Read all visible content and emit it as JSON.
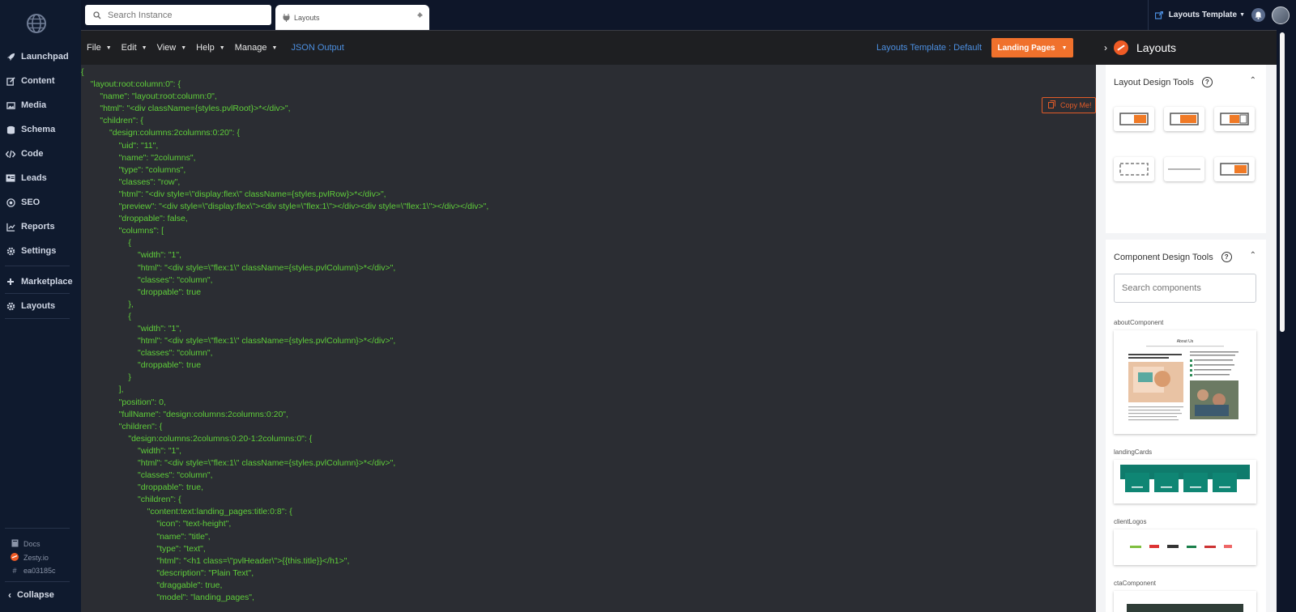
{
  "sidebar": {
    "items": [
      {
        "label": "Launchpad",
        "icon": "rocket-icon"
      },
      {
        "label": "Content",
        "icon": "edit-icon"
      },
      {
        "label": "Media",
        "icon": "image-icon"
      },
      {
        "label": "Schema",
        "icon": "database-icon"
      },
      {
        "label": "Code",
        "icon": "code-icon"
      },
      {
        "label": "Leads",
        "icon": "address-card-icon"
      },
      {
        "label": "SEO",
        "icon": "target-icon"
      },
      {
        "label": "Reports",
        "icon": "chart-icon"
      },
      {
        "label": "Settings",
        "icon": "gear-icon"
      },
      {
        "label": "Marketplace",
        "icon": "plus-icon"
      },
      {
        "label": "Layouts",
        "icon": "gear-icon"
      }
    ],
    "footer": {
      "docs": "Docs",
      "zesty": "Zesty.io",
      "hash": "ea03185c"
    },
    "collapse_label": "Collapse"
  },
  "topbar": {
    "search_placeholder": "Search Instance",
    "tab_label": "Layouts",
    "template_link": "Layouts Template"
  },
  "menubar": {
    "file": "File",
    "edit": "Edit",
    "view": "View",
    "help": "Help",
    "manage": "Manage",
    "json_output": "JSON Output",
    "template_label": "Layouts Template : Default",
    "landing_button": "Landing Pages"
  },
  "code": {
    "copy_label": "Copy Me!",
    "lines": [
      "{",
      "    \"layout:root:column:0\": {",
      "        \"name\": \"layout:root:column:0\",",
      "        \"html\": \"<div className={styles.pvlRoot}>*</div>\",",
      "        \"children\": {",
      "            \"design:columns:2columns:0:20\": {",
      "                \"uid\": \"11\",",
      "                \"name\": \"2columns\",",
      "                \"type\": \"columns\",",
      "                \"classes\": \"row\",",
      "                \"html\": \"<div style=\\\"display:flex\\\" className={styles.pvlRow}>*</div>\",",
      "                \"preview\": \"<div style=\\\"display:flex\\\"><div style=\\\"flex:1\\\"></div><div style=\\\"flex:1\\\"></div></div>\",",
      "                \"droppable\": false,",
      "                \"columns\": [",
      "                    {",
      "                        \"width\": \"1\",",
      "                        \"html\": \"<div style=\\\"flex:1\\\" className={styles.pvlColumn}>*</div>\",",
      "                        \"classes\": \"column\",",
      "                        \"droppable\": true",
      "                    },",
      "                    {",
      "                        \"width\": \"1\",",
      "                        \"html\": \"<div style=\\\"flex:1\\\" className={styles.pvlColumn}>*</div>\",",
      "                        \"classes\": \"column\",",
      "                        \"droppable\": true",
      "                    }",
      "                ],",
      "                \"position\": 0,",
      "                \"fullName\": \"design:columns:2columns:0:20\",",
      "                \"children\": {",
      "                    \"design:columns:2columns:0:20-1:2columns:0\": {",
      "                        \"width\": \"1\",",
      "                        \"html\": \"<div style=\\\"flex:1\\\" className={styles.pvlColumn}>*</div>\",",
      "                        \"classes\": \"column\",",
      "                        \"droppable\": true,",
      "                        \"children\": {",
      "                            \"content:text:landing_pages:title:0:8\": {",
      "                                \"icon\": \"text-height\",",
      "                                \"name\": \"title\",",
      "                                \"type\": \"text\",",
      "                                \"html\": \"<h1 class=\\\"pvlHeader\\\">{{this.title}}</h1>\",",
      "                                \"description\": \"Plain Text\",",
      "                                \"draggable\": true,",
      "                                \"model\": \"landing_pages\","
    ]
  },
  "panel": {
    "title": "Layouts",
    "layout_tools_title": "Layout Design Tools",
    "component_tools_title": "Component Design Tools",
    "component_search_placeholder": "Search components",
    "components": [
      {
        "label": "aboutComponent"
      },
      {
        "label": "landingCards"
      },
      {
        "label": "clientLogos"
      },
      {
        "label": "ctaComponent"
      }
    ],
    "about_thumb_title": "About Us",
    "accent": "#f07a26"
  },
  "colors": {
    "brand_orange": "#f0712c",
    "code_green": "#5fce3a",
    "link_blue": "#4c8fe0",
    "sidebar_bg": "#0f1a2e"
  }
}
